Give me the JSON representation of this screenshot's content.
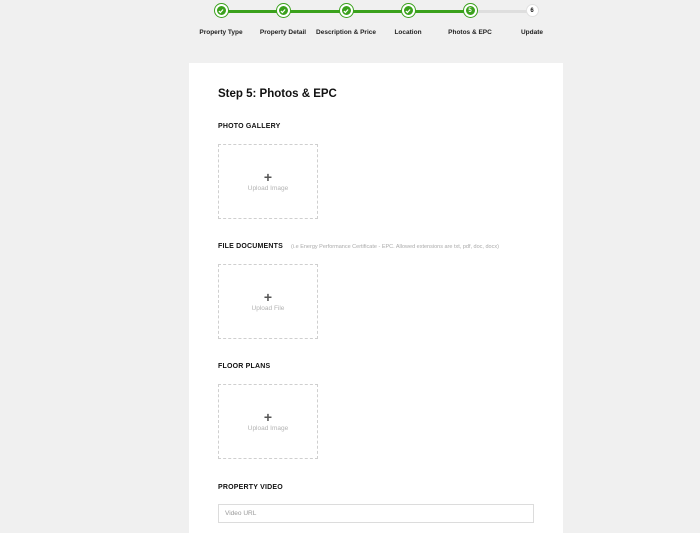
{
  "steps": [
    {
      "label": "Property Type",
      "number": "",
      "status": "done",
      "icon": "check-icon"
    },
    {
      "label": "Property Detail",
      "number": "",
      "status": "done",
      "icon": "check-icon"
    },
    {
      "label": "Description & Price",
      "number": "",
      "status": "done",
      "icon": "check-icon"
    },
    {
      "label": "Location",
      "number": "",
      "status": "done",
      "icon": "check-icon"
    },
    {
      "label": "Photos & EPC",
      "number": "5",
      "status": "current"
    },
    {
      "label": "Update",
      "number": "6",
      "status": "todo"
    }
  ],
  "form": {
    "title": "Step 5: Photos & EPC",
    "photo_gallery": {
      "title": "PHOTO GALLERY",
      "upload_label": "Upload Image"
    },
    "file_documents": {
      "title": "FILE DOCUMENTS",
      "note": "(i.e Energy Performance Certificate - EPC. Allowed extensions are txt, pdf, doc, docx)",
      "upload_label": "Upload File"
    },
    "floor_plans": {
      "title": "FLOOR PLANS",
      "upload_label": "Upload Image"
    },
    "property_video": {
      "title": "PROPERTY VIDEO",
      "placeholder": "Video URL",
      "value": ""
    }
  },
  "colors": {
    "accent": "#3aa11c",
    "background": "#f0f0f0",
    "card": "#ffffff"
  }
}
